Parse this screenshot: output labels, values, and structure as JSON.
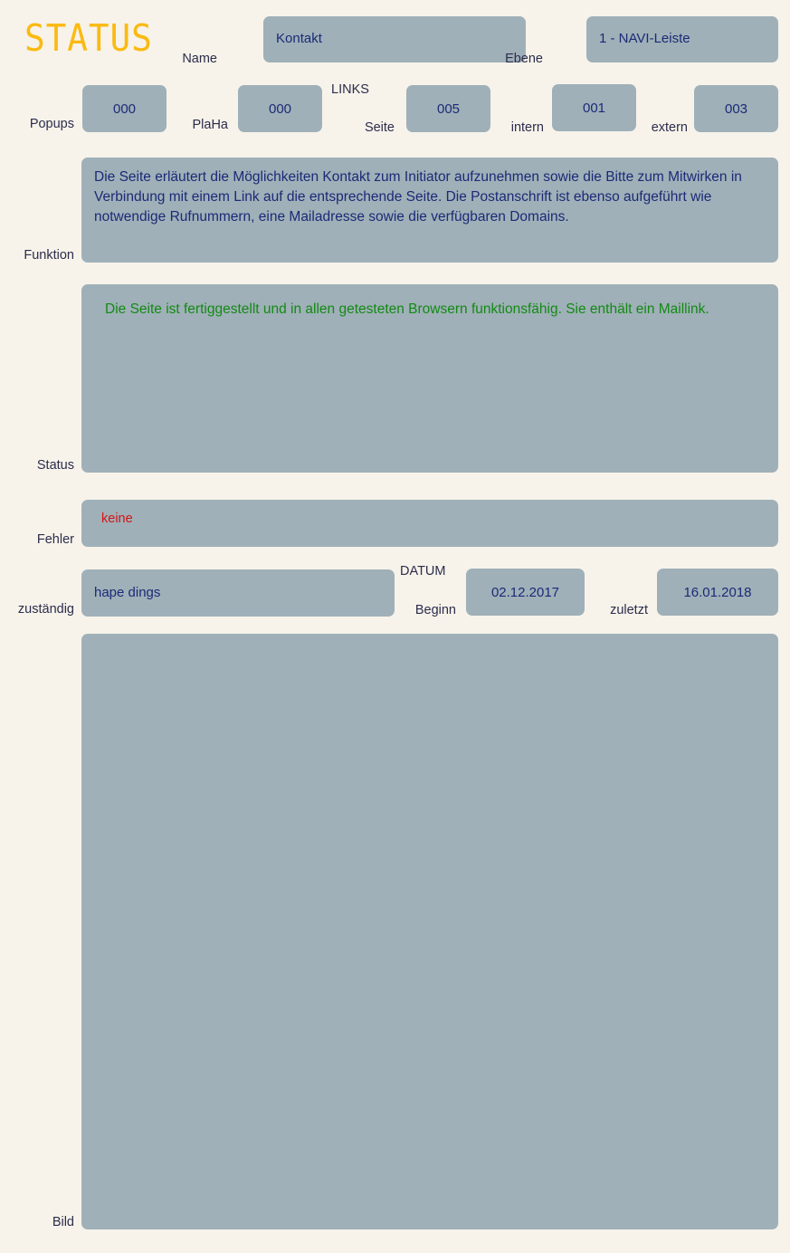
{
  "header": {
    "title": "STATUS",
    "name_label": "Name",
    "name_value": "Kontakt",
    "ebene_label": "Ebene",
    "ebene_value": "1 - NAVI-Leiste"
  },
  "counters": {
    "popups_label": "Popups",
    "popups_value": "000",
    "plaha_label": "PlaHa",
    "plaha_value": "000",
    "links_group_label": "LINKS",
    "seite_label": "Seite",
    "seite_value": "005",
    "intern_label": "intern",
    "intern_value": "001",
    "extern_label": "extern",
    "extern_value": "003"
  },
  "funktion": {
    "label": "Funktion",
    "text": "Die Seite erläutert die Möglichkeiten Kontakt zum Initiator aufzunehmen sowie die Bitte zum Mitwirken in Verbindung mit einem Link auf die entsprechende Seite. Die Postanschrift ist ebenso aufgeführt wie notwendige Rufnummern, eine Mailadresse sowie die verfügbaren Domains."
  },
  "status": {
    "label": "Status",
    "text": "Die Seite ist fertiggestellt und in allen getesteten Browsern funktionsfähig. Sie enthält ein Maillink."
  },
  "fehler": {
    "label": "Fehler",
    "text": "keine"
  },
  "zustaendig": {
    "label": "zuständig",
    "value": "hape dings"
  },
  "datum": {
    "group_label": "DATUM",
    "beginn_label": "Beginn",
    "beginn_value": "02.12.2017",
    "zuletzt_label": "zuletzt",
    "zuletzt_value": "16.01.2018"
  },
  "bild": {
    "label": "Bild",
    "value": ""
  },
  "colors": {
    "background": "#f7f3ea",
    "field": "#9fb0b8",
    "title_accent": "#fbba12",
    "value_text": "#1b2a77",
    "label_text": "#2c2c4c",
    "status_ok": "#138a13",
    "error": "#d41515"
  }
}
